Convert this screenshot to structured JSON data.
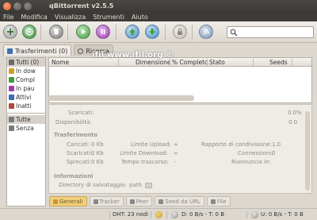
{
  "window": {
    "title": "qBittorrent v2.5.5"
  },
  "menu": [
    "File",
    "Modifica",
    "Visualizza",
    "Strumenti",
    "Aiuto"
  ],
  "toolbar": {
    "buttons": [
      {
        "name": "add-torrent-file-button",
        "icon": "add-file-icon",
        "color": "#9a9a9a"
      },
      {
        "name": "add-torrent-link-button",
        "icon": "add-link-icon",
        "color": "#3a8a3a"
      },
      {
        "name": "delete-button",
        "icon": "delete-icon",
        "color": "#7a7a7a"
      },
      {
        "name": "start-button",
        "icon": "play-icon",
        "color": "#3d9a3d"
      },
      {
        "name": "pause-button",
        "icon": "pause-icon",
        "color": "#9c3cb0"
      },
      {
        "name": "increase-priority-button",
        "icon": "up-arrow-icon",
        "color": "#3b87c8"
      },
      {
        "name": "decrease-priority-button",
        "icon": "down-arrow-icon",
        "color": "#3b87c8"
      },
      {
        "name": "preferences-button",
        "icon": "lock-icon",
        "color": "#bfb9b0"
      },
      {
        "name": "rss-button",
        "icon": "rss-icon",
        "color": "#7a92b8"
      }
    ]
  },
  "search": {
    "placeholder": ""
  },
  "tabs": [
    {
      "label": "Trasferimenti (0)",
      "active": true
    },
    {
      "label": "Ricerca",
      "active": false
    }
  ],
  "watermark": "ifil www.ifil.org ©",
  "sidebar": {
    "status_items": [
      {
        "label": "Tutti (0)",
        "color": "#6a6a6a",
        "selected": true
      },
      {
        "label": "In dow",
        "color": "#d0a022"
      },
      {
        "label": "Compl",
        "color": "#3d9a3d"
      },
      {
        "label": "In pau",
        "color": "#9c3cb0"
      },
      {
        "label": "Attivi",
        "color": "#3b6fb0"
      },
      {
        "label": "Inatti",
        "color": "#b04a3a"
      }
    ],
    "label_items": [
      {
        "label": "Tutte",
        "color": "#7a7a7a",
        "selected": true
      },
      {
        "label": "Senza",
        "color": "#7a7a7a"
      }
    ]
  },
  "torrent_list": {
    "columns": [
      "Nome",
      "Dimensione",
      "% Completo",
      "Stato",
      "Seeds"
    ]
  },
  "details": {
    "downloaded_label": "Scaricati:",
    "downloaded_value": "0.0%",
    "availability_label": "Disponibilità:",
    "availability_value": "0.0",
    "transfer_title": "Trasferimento",
    "uploaded_label": "Caricati:",
    "uploaded_value": "0 Kb",
    "dl_label": "Scaricati:",
    "dl_value": "0 Kb",
    "wasted_label": "Sprecati:",
    "wasted_value": "0 Kb",
    "up_limit_label": "Limite Upload:",
    "up_limit_value": "∞",
    "dl_limit_label": "Limite Download:",
    "dl_limit_value": "∞",
    "elapsed_label": "Tempo trascorso:",
    "elapsed_value": "-",
    "ratio_label": "Rapporto di condivisione:",
    "ratio_value": "1.0",
    "connections_label": "Connessioni:",
    "connections_value": "0",
    "reannounce_label": "Riannuncia in:",
    "reannounce_value": "",
    "info_title": "Informazioni",
    "save_dir_label": "Directory di salvataggio:",
    "save_dir_value": "path"
  },
  "bottom_tabs": [
    {
      "label": "Generali",
      "active": true,
      "color": "#c89a3a"
    },
    {
      "label": "Tracker",
      "color": "#8a8a8a"
    },
    {
      "label": "Peer",
      "color": "#8a8a8a"
    },
    {
      "label": "Seed da URL",
      "color": "#8a8a8a"
    },
    {
      "label": "File",
      "color": "#8a8a8a"
    }
  ],
  "status": {
    "dht": "DHT: 23 nodi",
    "download": "D: 0 B/s - T: 0 B",
    "upload": "U: 0 B/s - T: 0 B"
  }
}
